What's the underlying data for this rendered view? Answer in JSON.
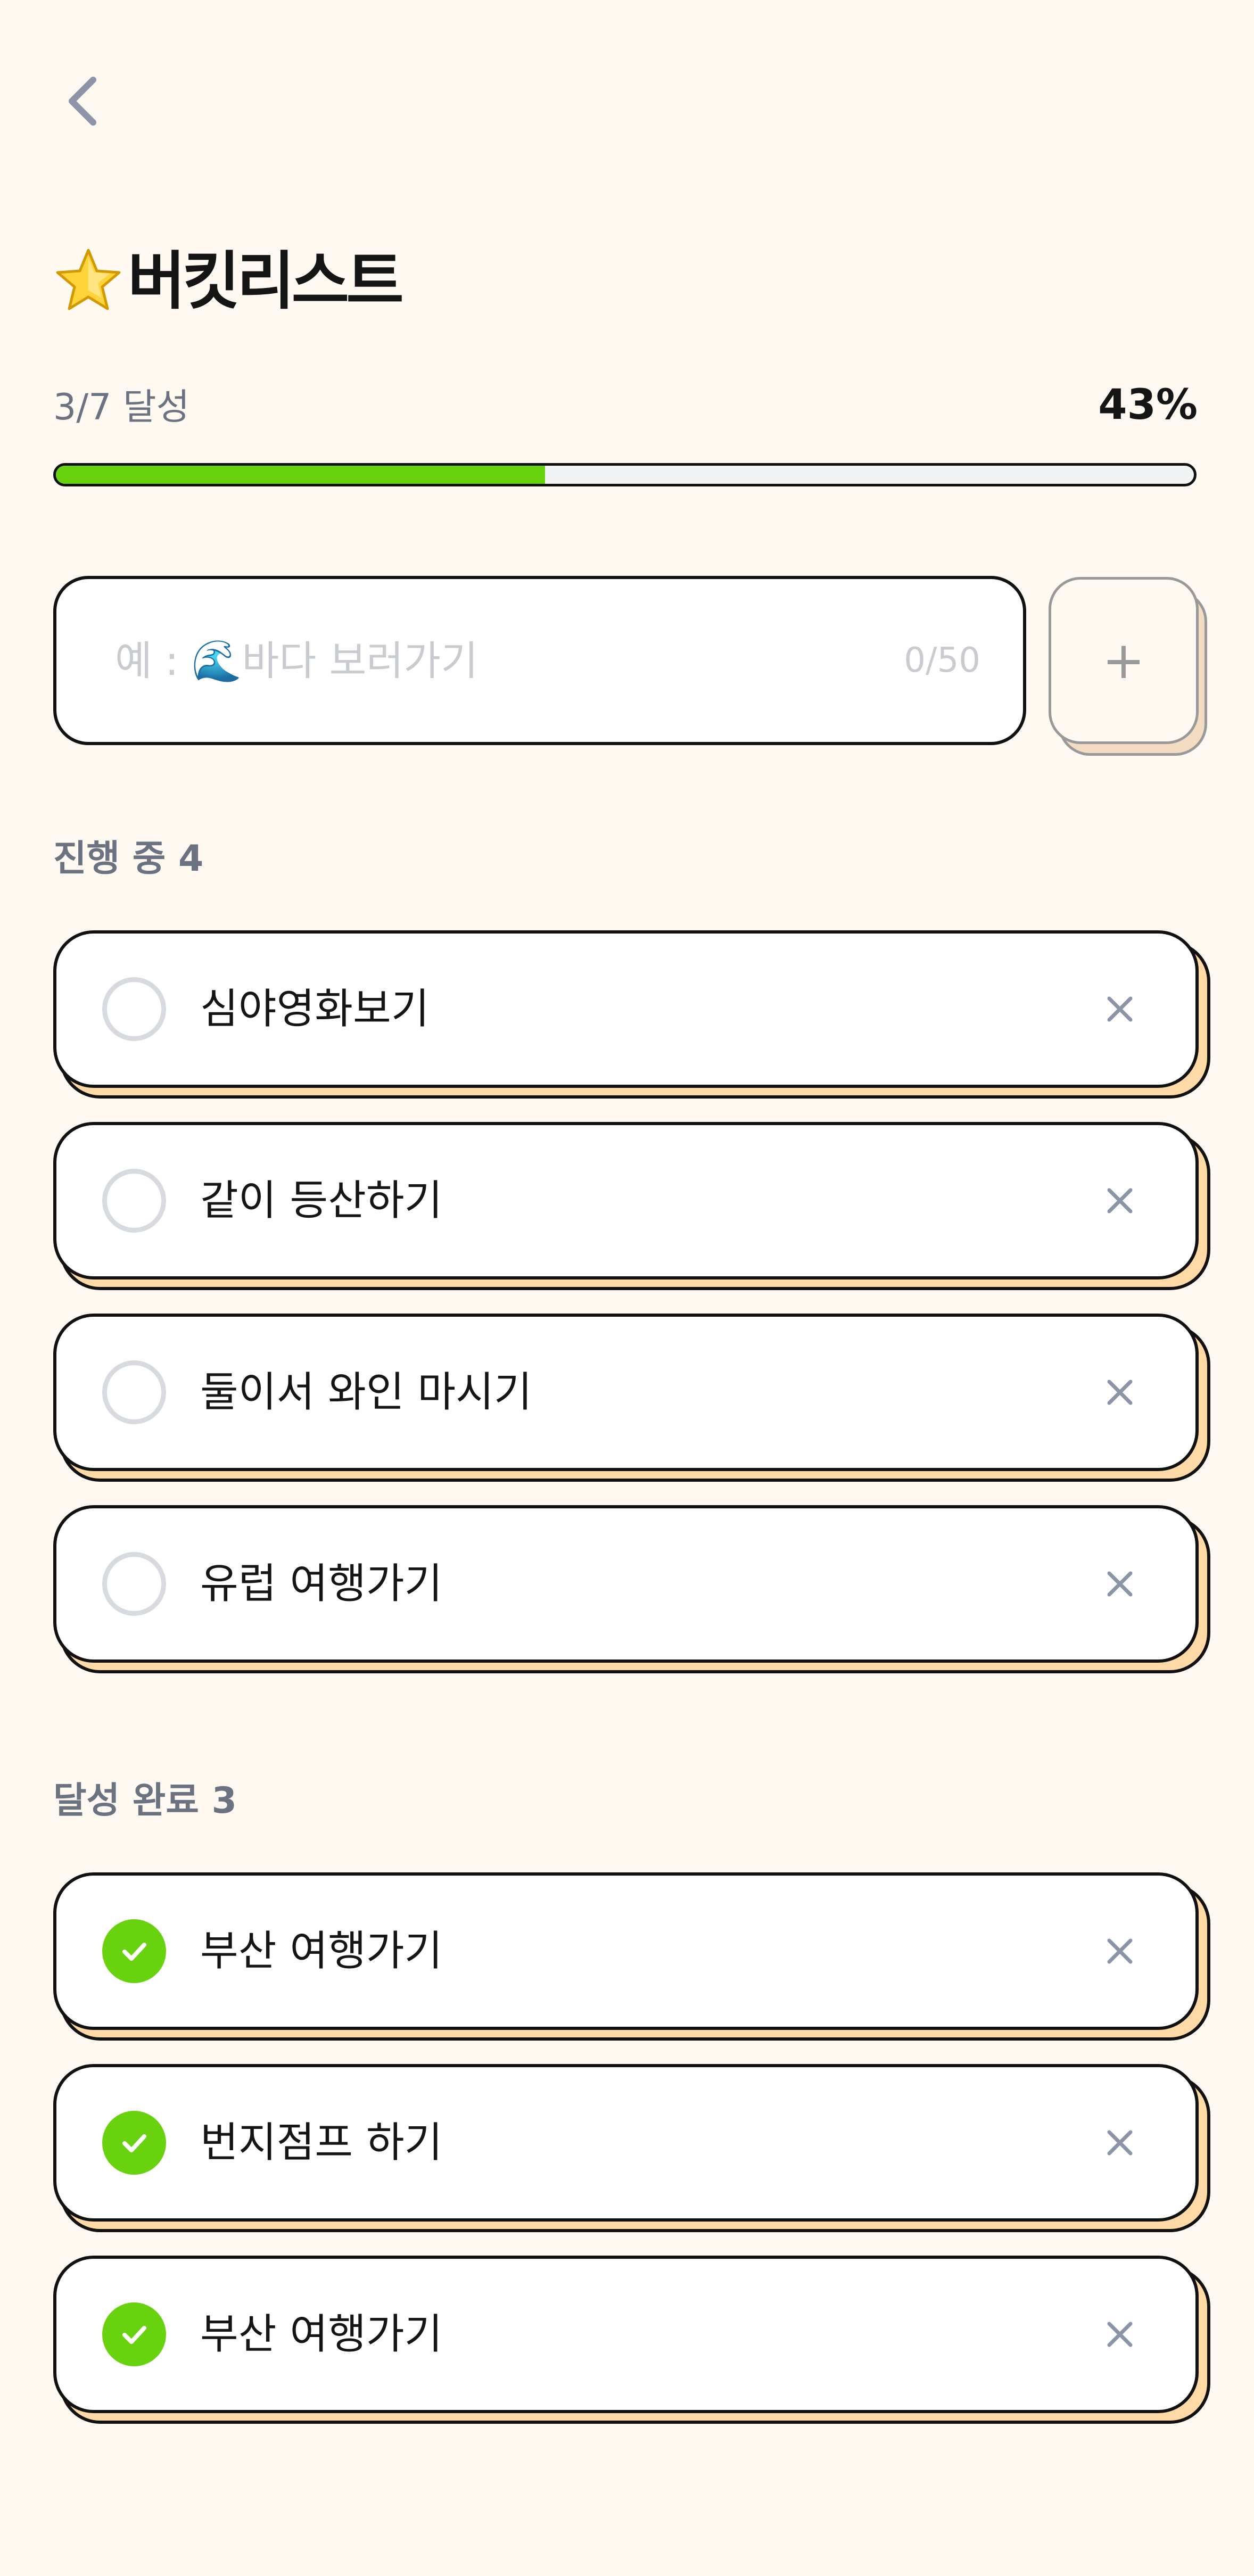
{
  "header": {
    "back_icon": "chevron-left-icon",
    "title": "버킷리스트",
    "title_icon": "star-icon"
  },
  "progress": {
    "label": "3/7 달성",
    "percent": "43%",
    "completed": 3,
    "total": 7,
    "fraction": 0.43
  },
  "input": {
    "value": "",
    "placeholder": "예 : 🌊바다 보러가기",
    "counter": "0/50",
    "add_label": "+"
  },
  "sections": {
    "active": {
      "title": "진행 중 4",
      "items": [
        {
          "label": "심야영화보기",
          "done": false
        },
        {
          "label": "같이 등산하기",
          "done": false
        },
        {
          "label": "둘이서 와인 마시기",
          "done": false
        },
        {
          "label": "유럽 여행가기",
          "done": false
        }
      ]
    },
    "done": {
      "title": "달성 완료 3",
      "items": [
        {
          "label": "부산 여행가기",
          "done": true
        },
        {
          "label": "번지점프 하기",
          "done": true
        },
        {
          "label": "부산 여행가기",
          "done": true
        }
      ]
    }
  },
  "colors": {
    "background": "#fff9f2",
    "accent_green": "#67d20d",
    "card_shadow": "#ffd9a6",
    "muted_text": "#6b7280",
    "placeholder": "#c8cbcf"
  }
}
